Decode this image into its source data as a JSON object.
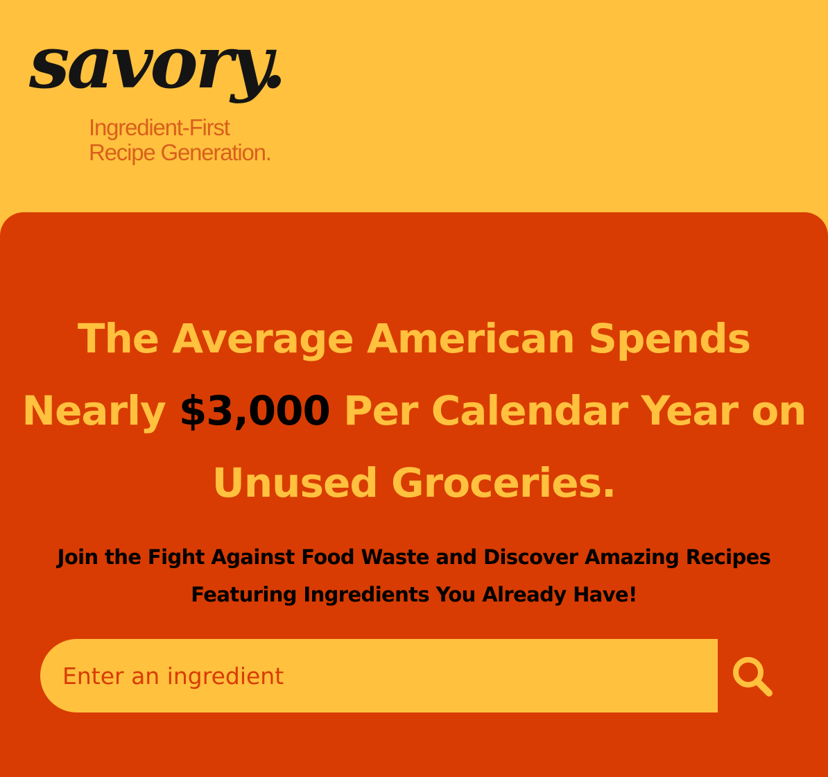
{
  "brand": {
    "logo_text": "savory.",
    "tagline_line1": "Ingredient-First",
    "tagline_line2": "Recipe Generation."
  },
  "hero": {
    "headline_part1": "The Average American Spends Nearly ",
    "headline_amount": "$3,000",
    "headline_part2": " Per Calendar Year on Unused Groceries.",
    "subheadline": "Join the Fight Against Food Waste and Discover Amazing Recipes Featuring Ingredients You Already Have!"
  },
  "search": {
    "placeholder": "Enter an ingredient",
    "value": "",
    "button_icon": "search-icon"
  },
  "colors": {
    "background": "#FFC13E",
    "panel": "#D83C02",
    "accent_text": "#D8601C",
    "dark_text": "#000000"
  }
}
